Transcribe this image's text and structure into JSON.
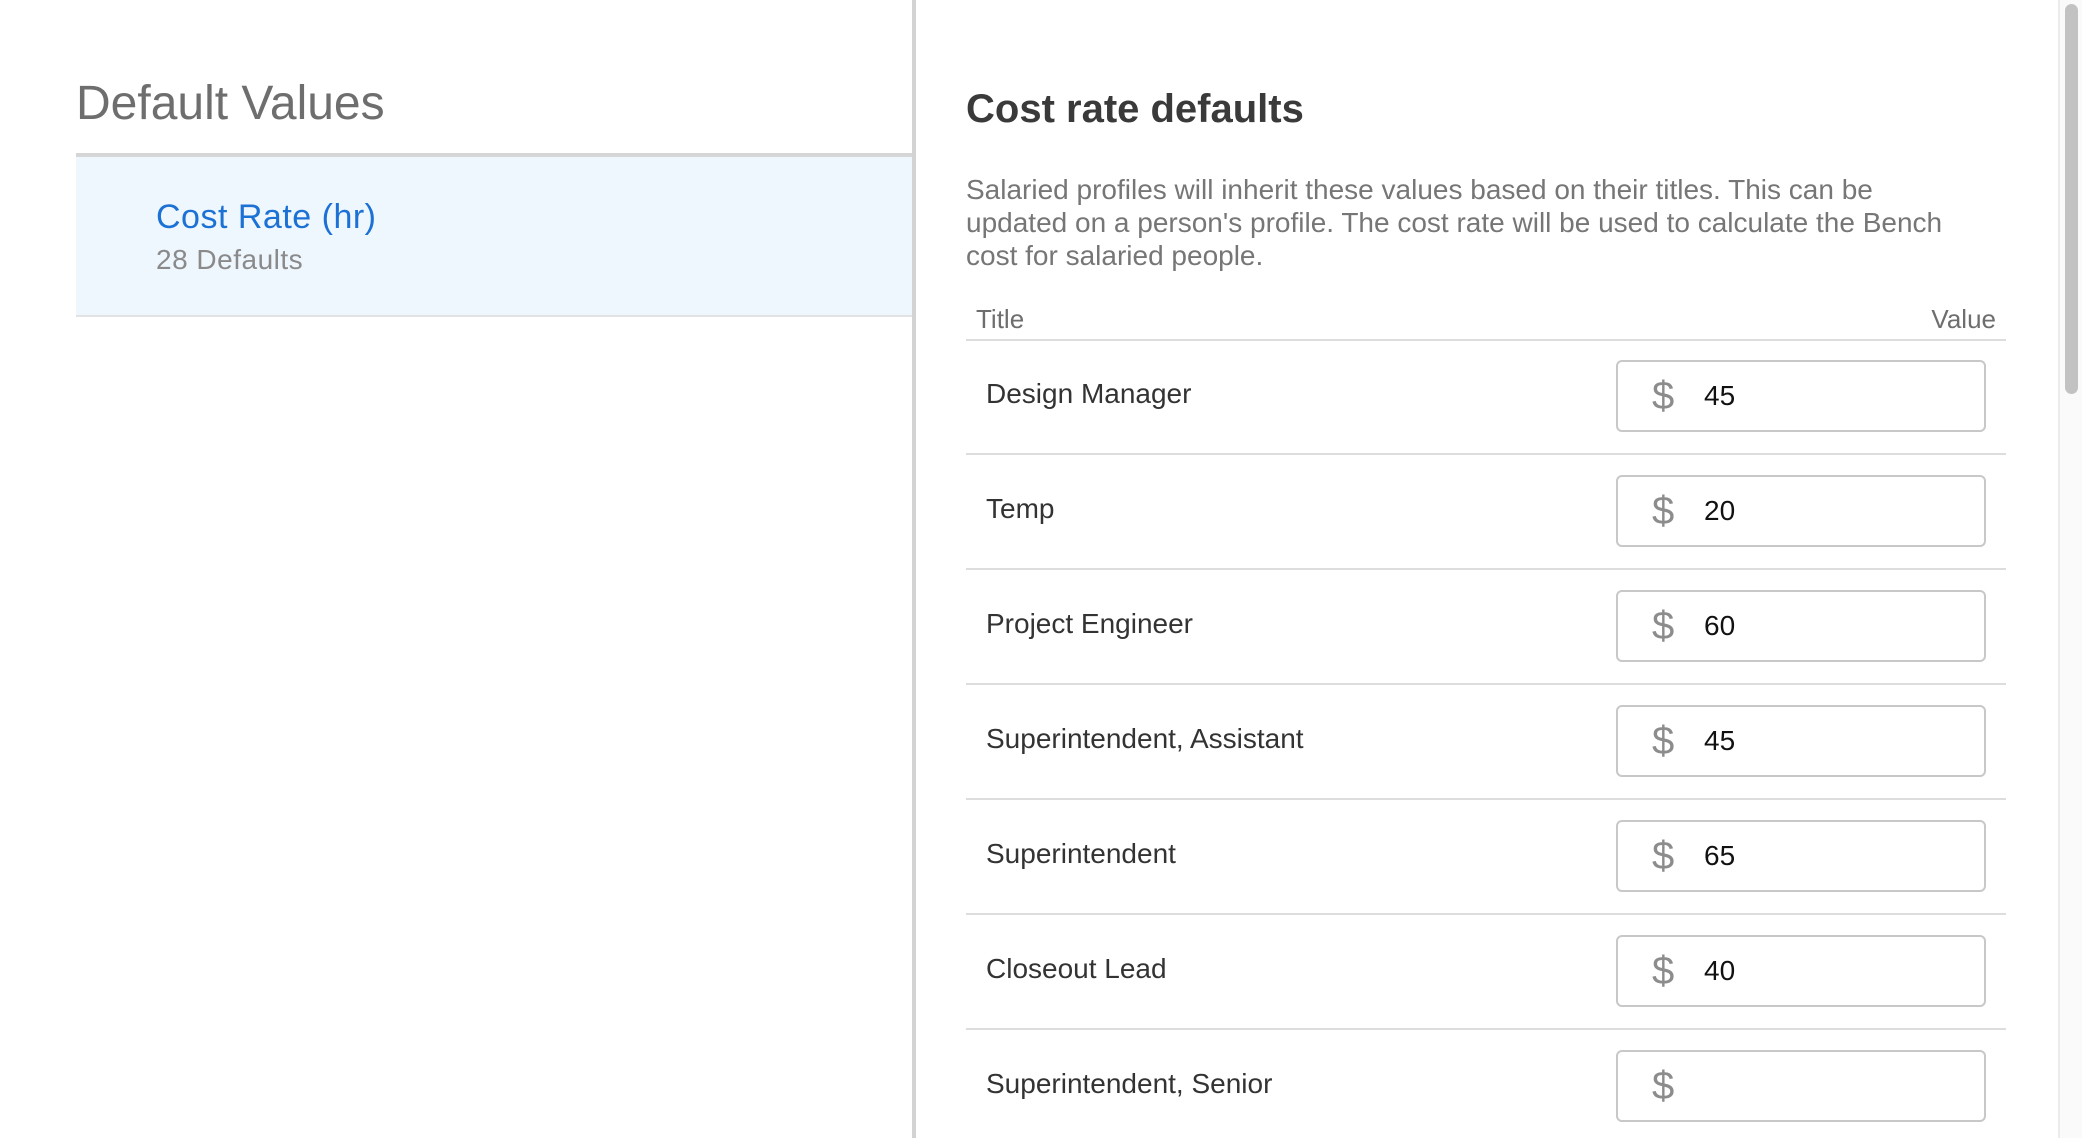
{
  "sidebar": {
    "title": "Default Values",
    "categories": [
      {
        "name": "Cost Rate (hr)",
        "count": "28 Defaults"
      }
    ]
  },
  "main": {
    "title": "Cost rate defaults",
    "description": "Salaried profiles will inherit these values based on their titles. This can be updated on a person's profile. The cost rate will be used to calculate the Bench cost for salaried people.",
    "table": {
      "columns": {
        "title": "Title",
        "value": "Value"
      },
      "currency_symbol": "$",
      "rows": [
        {
          "title": "Design Manager",
          "value": "45"
        },
        {
          "title": "Temp",
          "value": "20"
        },
        {
          "title": "Project Engineer",
          "value": "60"
        },
        {
          "title": "Superintendent, Assistant",
          "value": "45"
        },
        {
          "title": "Superintendent",
          "value": "65"
        },
        {
          "title": "Closeout Lead",
          "value": "40"
        },
        {
          "title": "Superintendent, Senior",
          "value": ""
        }
      ]
    }
  },
  "colors": {
    "accent": "#1c72d4",
    "selected_bg": "#eef6fe"
  }
}
